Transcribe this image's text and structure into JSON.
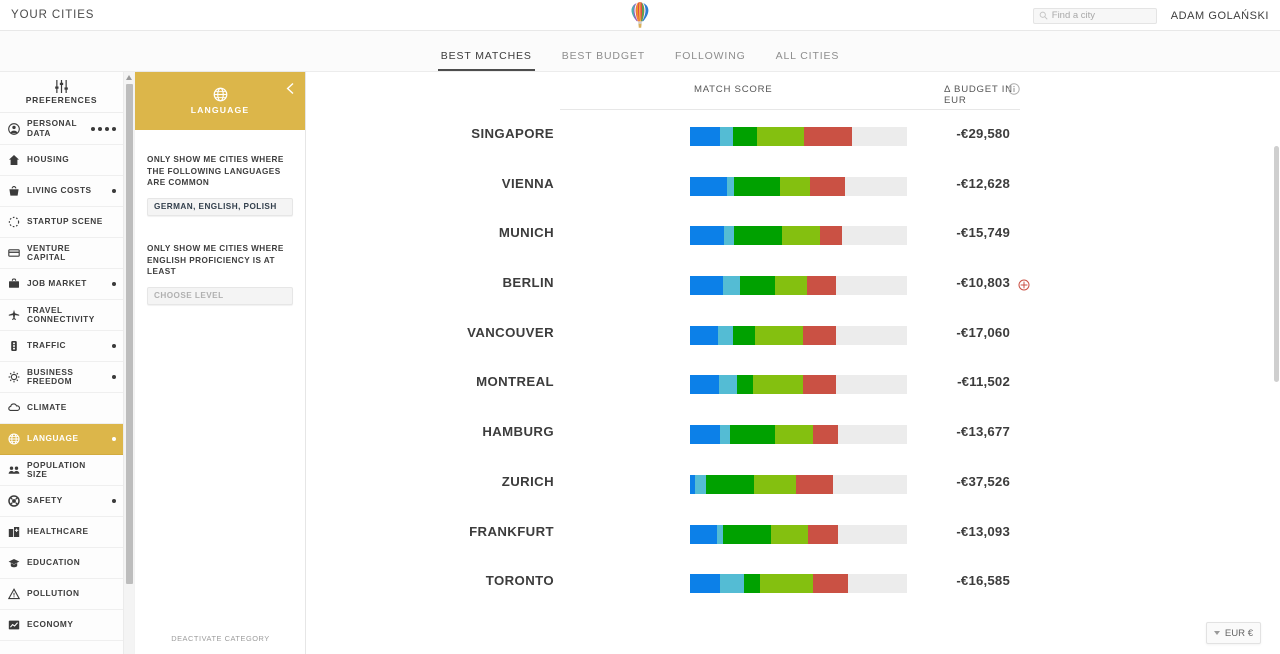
{
  "header": {
    "brand_label": "YOUR CITIES",
    "logo_icon": "hot-air-balloon-icon",
    "search": {
      "placeholder": "Find a city",
      "value": "",
      "icon": "search-icon"
    },
    "user_name": "ADAM GOLAŃSKI"
  },
  "nav": {
    "tabs": [
      {
        "label": "BEST MATCHES",
        "active": true
      },
      {
        "label": "BEST BUDGET",
        "active": false
      },
      {
        "label": "FOLLOWING",
        "active": false
      },
      {
        "label": "ALL CITIES",
        "active": false
      }
    ]
  },
  "sidebar": {
    "head": {
      "label": "PREFERENCES",
      "icon": "sliders-icon"
    },
    "items": [
      {
        "label": "PERSONAL DATA",
        "icon": "user-circle-icon",
        "dots": 4,
        "active": false
      },
      {
        "label": "HOUSING",
        "icon": "home-icon",
        "dots": 0,
        "active": false
      },
      {
        "label": "LIVING COSTS",
        "icon": "shopping-basket-icon",
        "dots": 1,
        "active": false
      },
      {
        "label": "STARTUP SCENE",
        "icon": "dotted-circle-icon",
        "dots": 0,
        "active": false
      },
      {
        "label": "VENTURE CAPITAL",
        "icon": "credit-card-icon",
        "dots": 0,
        "active": false
      },
      {
        "label": "JOB MARKET",
        "icon": "briefcase-icon",
        "dots": 1,
        "active": false
      },
      {
        "label": "TRAVEL CONNECTIVITY",
        "icon": "airplane-icon",
        "dots": 0,
        "active": false
      },
      {
        "label": "TRAFFIC",
        "icon": "traffic-light-icon",
        "dots": 1,
        "active": false
      },
      {
        "label": "BUSINESS FREEDOM",
        "icon": "gear-icon",
        "dots": 1,
        "active": false
      },
      {
        "label": "CLIMATE",
        "icon": "cloud-icon",
        "dots": 0,
        "active": false
      },
      {
        "label": "LANGUAGE",
        "icon": "globe-icon",
        "dots": 1,
        "active": true
      },
      {
        "label": "POPULATION SIZE",
        "icon": "people-icon",
        "dots": 0,
        "active": false
      },
      {
        "label": "SAFETY",
        "icon": "lifebuoy-icon",
        "dots": 1,
        "active": false
      },
      {
        "label": "HEALTHCARE",
        "icon": "hospital-icon",
        "dots": 0,
        "active": false
      },
      {
        "label": "EDUCATION",
        "icon": "graduation-cap-icon",
        "dots": 0,
        "active": false
      },
      {
        "label": "POLLUTION",
        "icon": "warning-triangle-icon",
        "dots": 0,
        "active": false
      },
      {
        "label": "ECONOMY",
        "icon": "chart-line-icon",
        "dots": 0,
        "active": false
      }
    ]
  },
  "panel": {
    "title": "LANGUAGE",
    "icon": "globe-icon",
    "collapse_icon": "chevron-left-icon",
    "accent_color": "#dcb64a",
    "question_1": "ONLY SHOW ME CITIES WHERE THE FOLLOWING LANGUAGES ARE COMMON",
    "field_1_value": "GERMAN, ENGLISH, POLISH",
    "question_2": "ONLY SHOW ME CITIES WHERE ENGLISH PROFICIENCY IS AT LEAST",
    "field_2_placeholder": "CHOOSE LEVEL",
    "deactivate_label": "DEACTIVATE CATEGORY"
  },
  "main": {
    "columns": {
      "match_score": "MATCH SCORE",
      "budget": "Δ BUDGET IN EUR",
      "info_icon": "info-circle-icon"
    },
    "currency": {
      "label": "EUR €",
      "caret_icon": "caret-down-icon"
    },
    "add_icon": "plus-circle-icon"
  },
  "chart_data": {
    "type": "bar",
    "title": "MATCH SCORE",
    "xlabel": "",
    "ylabel": "",
    "orientation": "horizontal",
    "stacked": true,
    "track_max": 217,
    "segment_colors": [
      "#0c80e8",
      "#54bcd4",
      "#00a100",
      "#84c010",
      "#ca5144"
    ],
    "track_color": "#ececec",
    "series": [
      {
        "name": "segment-1",
        "color": "#0c80e8"
      },
      {
        "name": "segment-2",
        "color": "#54bcd4"
      },
      {
        "name": "segment-3",
        "color": "#00a100"
      },
      {
        "name": "segment-4",
        "color": "#84c010"
      },
      {
        "name": "segment-5",
        "color": "#ca5144"
      }
    ],
    "categories": [
      "SINGAPORE",
      "VIENNA",
      "MUNICH",
      "BERLIN",
      "VANCOUVER",
      "MONTREAL",
      "HAMBURG",
      "ZURICH",
      "FRANKFURT",
      "TORONTO"
    ],
    "rows": [
      {
        "city": "SINGAPORE",
        "budget": "-€29,580",
        "segments": [
          30,
          13,
          24,
          47,
          48
        ],
        "highlight": false
      },
      {
        "city": "VIENNA",
        "budget": "-€12,628",
        "segments": [
          37,
          7,
          46,
          30,
          35
        ],
        "highlight": false
      },
      {
        "city": "MUNICH",
        "budget": "-€15,749",
        "segments": [
          34,
          10,
          48,
          38,
          22
        ],
        "highlight": false
      },
      {
        "city": "BERLIN",
        "budget": "-€10,803",
        "segments": [
          33,
          17,
          35,
          32,
          29
        ],
        "highlight": true
      },
      {
        "city": "VANCOUVER",
        "budget": "-€17,060",
        "segments": [
          28,
          15,
          22,
          48,
          33
        ],
        "highlight": false
      },
      {
        "city": "MONTREAL",
        "budget": "-€11,502",
        "segments": [
          29,
          18,
          16,
          50,
          33
        ],
        "highlight": false
      },
      {
        "city": "HAMBURG",
        "budget": "-€13,677",
        "segments": [
          30,
          10,
          45,
          38,
          25
        ],
        "highlight": false
      },
      {
        "city": "ZURICH",
        "budget": "-€37,526",
        "segments": [
          5,
          11,
          48,
          42,
          37
        ],
        "highlight": false
      },
      {
        "city": "FRANKFURT",
        "budget": "-€13,093",
        "segments": [
          27,
          6,
          48,
          37,
          30
        ],
        "highlight": false
      },
      {
        "city": "TORONTO",
        "budget": "-€16,585",
        "segments": [
          30,
          24,
          16,
          53,
          35
        ],
        "highlight": false
      }
    ]
  }
}
